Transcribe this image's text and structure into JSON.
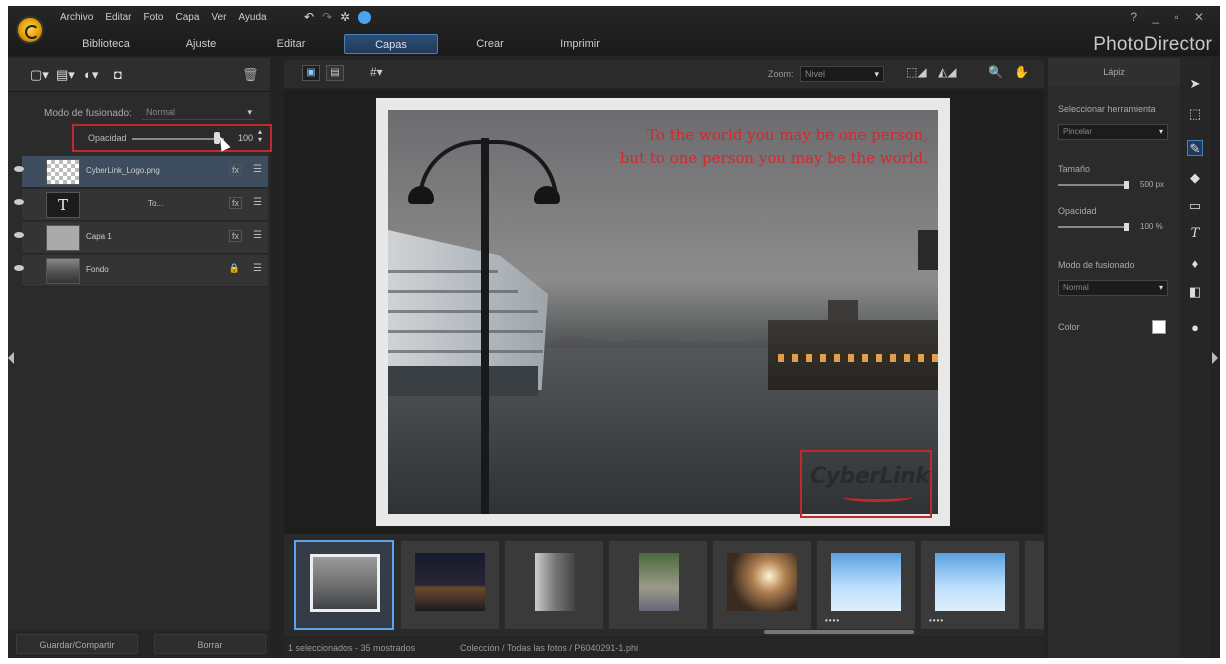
{
  "app": {
    "brand": "PhotoDirector",
    "window_controls": "?  _  ▫  ✕"
  },
  "menu": [
    "Archivo",
    "Editar",
    "Foto",
    "Capa",
    "Ver",
    "Ayuda"
  ],
  "modes": {
    "library": "Biblioteca",
    "adjust": "Ajuste",
    "edit": "Editar",
    "layers": "Capas",
    "create": "Crear",
    "print": "Imprimir",
    "active": "Capas"
  },
  "left_panel": {
    "blend_label": "Modo de fusionado:",
    "blend_value": "Normal",
    "opacity_label": "Opacidad",
    "opacity_value": "100",
    "opacity_fraction": 1.0,
    "layers": [
      {
        "name": "CyberLink_Logo.png",
        "fx": "fx",
        "selected": true
      },
      {
        "name": "To...",
        "fx": "fx",
        "thumb_label": "T"
      },
      {
        "name": "Capa 1",
        "fx": "fx"
      },
      {
        "name": "Fondo",
        "fx": "🔒"
      }
    ],
    "save_share": "Guardar/Compartir",
    "delete": "Borrar"
  },
  "toolbar": {
    "zoom_label": "Zoom:",
    "zoom_value": "Nivel"
  },
  "canvas": {
    "quote_line1": "To the world you may be one person,",
    "quote_line2": "but to one person you may be the world.",
    "logo_text": "CyberLink"
  },
  "filmstrip": {
    "dots": "••••",
    "status_selected": "1 seleccionados - 35 mostrados",
    "status_path": "Colección / Todas las fotos / P6040291-1.phi"
  },
  "right_panel": {
    "title": "Lápiz",
    "select_tool_label": "Seleccionar herramienta",
    "select_tool_value": "Pincelar",
    "size_label": "Tamaño",
    "size_value": "500 px",
    "size_fraction": 1.0,
    "opacity_label": "Opacidad",
    "opacity_value": "100 %",
    "opacity_fraction": 1.0,
    "blend_label": "Modo de fusionado",
    "blend_value": "Normal",
    "color_label": "Color"
  },
  "colors": {
    "accent": "#4a7fb5",
    "highlight": "#c1272d",
    "quote": "#d8262c"
  }
}
